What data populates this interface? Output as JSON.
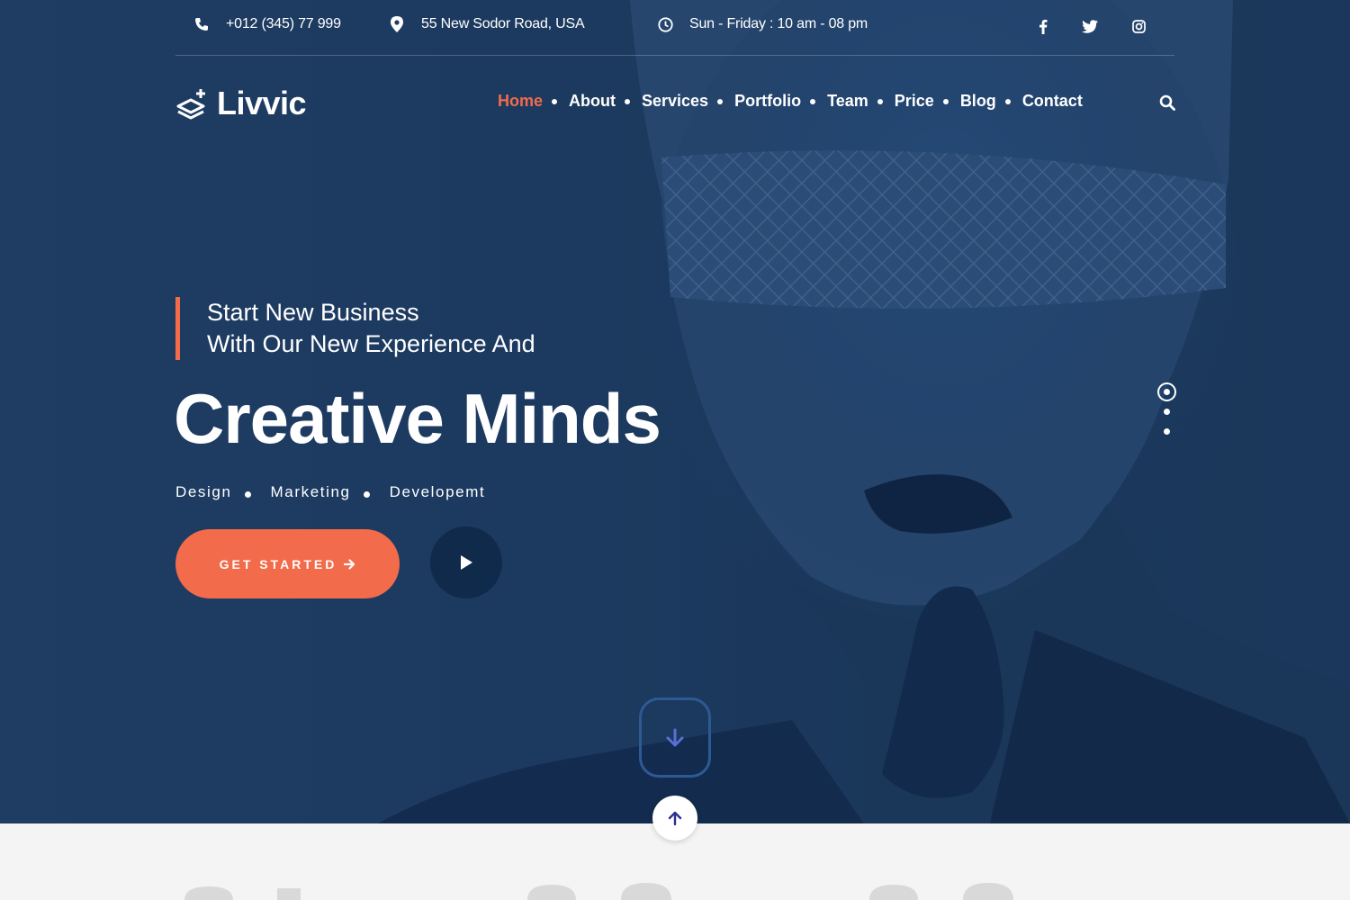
{
  "topbar": {
    "phone": "+012 (345) 77 999",
    "address": "55 New Sodor Road, USA",
    "hours": "Sun - Friday : 10 am - 08 pm",
    "social": [
      "facebook-icon",
      "twitter-icon",
      "instagram-icon"
    ]
  },
  "brand": {
    "name": "Livvic"
  },
  "nav": {
    "items": [
      {
        "label": "Home",
        "active": true
      },
      {
        "label": "About"
      },
      {
        "label": "Services"
      },
      {
        "label": "Portfolio"
      },
      {
        "label": "Team"
      },
      {
        "label": "Price"
      },
      {
        "label": "Blog"
      },
      {
        "label": "Contact"
      }
    ]
  },
  "hero": {
    "subtitle_line1": "Start New Business",
    "subtitle_line2": "With Our New Experience And",
    "headline": "Creative Minds",
    "tags": [
      "Design",
      "Marketing",
      "Developemt"
    ],
    "cta_label": "GET STARTED"
  },
  "slider": {
    "count": 3,
    "active_index": 0
  },
  "colors": {
    "accent": "#f26b4a",
    "hero_bg": "#1c3a60",
    "dark_button": "#0f2a4b",
    "scroll_border": "#2d5a94",
    "scroll_arrow": "#5a6fd8"
  }
}
